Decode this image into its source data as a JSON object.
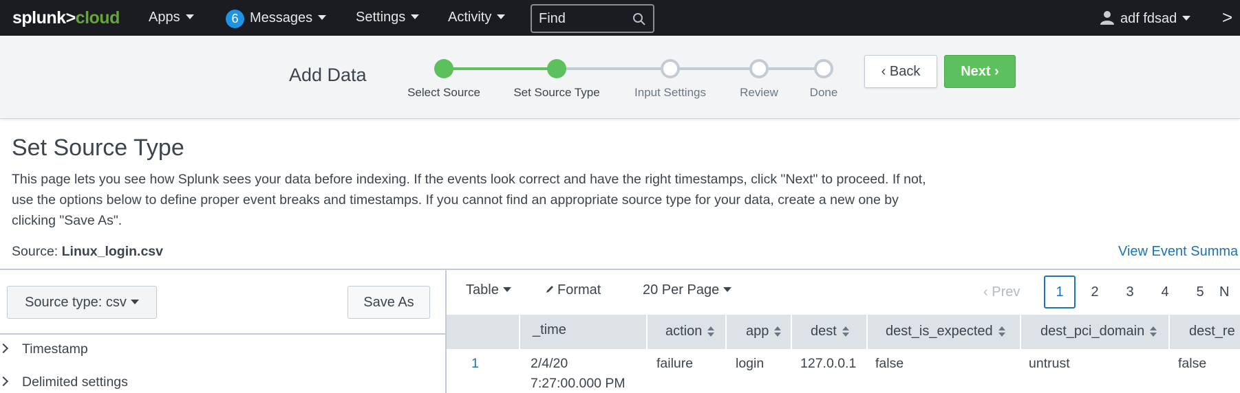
{
  "topbar": {
    "logo_part1": "splunk>",
    "logo_part2": "cloud",
    "apps": "Apps",
    "messages_count": "6",
    "messages": "Messages",
    "settings": "Settings",
    "activity": "Activity",
    "find_placeholder": "Find",
    "user": "adf fdsad",
    "more": ">"
  },
  "wizard": {
    "title": "Add Data",
    "steps": [
      {
        "label": "Select Source",
        "state": "done"
      },
      {
        "label": "Set Source Type",
        "state": "current"
      },
      {
        "label": "Input Settings",
        "state": "todo"
      },
      {
        "label": "Review",
        "state": "todo"
      },
      {
        "label": "Done",
        "state": "todo"
      }
    ],
    "back": "Back",
    "next": "Next"
  },
  "page": {
    "title": "Set Source Type",
    "description": "This page lets you see how Splunk sees your data before indexing. If the events look correct and have the right timestamps, click \"Next\" to proceed. If not, use the options below to define proper event breaks and timestamps. If you cannot find an appropriate source type for your data, create a new one by clicking \"Save As\".",
    "source_label": "Source:",
    "source_value": "Linux_login.csv",
    "view_summary": "View Event Summa"
  },
  "left_panel": {
    "source_type_button": "Source type: csv",
    "save_as": "Save As",
    "sections": [
      "Timestamp",
      "Delimited settings"
    ]
  },
  "results": {
    "view_mode": "Table",
    "format": "Format",
    "per_page": "20 Per Page",
    "prev": "Prev",
    "pages": [
      "1",
      "2",
      "3",
      "4",
      "5",
      "N"
    ],
    "active_page": "1",
    "columns": [
      "",
      "_time",
      "action",
      "app",
      "dest",
      "dest_is_expected",
      "dest_pci_domain",
      "dest_re"
    ],
    "rows": [
      {
        "index": "1",
        "time_date": "2/4/20",
        "time_clock": "7:27:00.000 PM",
        "action": "failure",
        "app": "login",
        "dest": "127.0.0.1",
        "dest_is_expected": "false",
        "dest_pci_domain": "untrust",
        "dest_re": "false"
      }
    ]
  },
  "colors": {
    "topbar_bg": "#1a1c21",
    "logo_accent": "#65a637",
    "badge": "#1e93e3",
    "step_done": "#5cc05c",
    "step_todo": "#c3cbd4",
    "primary_button": "#5cc05c",
    "link": "#1a73b8"
  }
}
